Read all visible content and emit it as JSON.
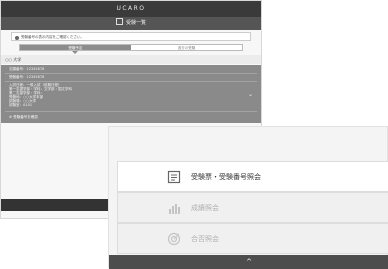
{
  "app": {
    "brand": "UCARO"
  },
  "header": {
    "title": "受験一覧"
  },
  "notice": {
    "text": "受験番号の表示内容をご確認ください。"
  },
  "tabs": [
    {
      "label": "受験予定",
      "active": true
    },
    {
      "label": "過去の受験",
      "active": false
    }
  ],
  "section": {
    "title": "○○ 大学"
  },
  "panel": {
    "rows": [
      "志願番号：12345678",
      "受験番号：12345678",
      "入試日程：一般入試（前期日程）",
      "第一志望学部・学科：文学部・国文学科",
      "第二志望学部・学科：",
      "受験地：○○大学本部",
      "試験場：○○大学",
      "試験室：A101"
    ],
    "footer": "受験番号を確認"
  },
  "menu": {
    "items": [
      {
        "label": "受験票・受験番号照会",
        "icon": "document-list-icon",
        "enabled": true
      },
      {
        "label": "成績照会",
        "icon": "bar-chart-icon",
        "enabled": false
      },
      {
        "label": "合否照会",
        "icon": "target-icon",
        "enabled": false
      }
    ]
  },
  "bottom": {
    "chevron": "^"
  },
  "colors": {
    "dark_bar": "#3a3a3a",
    "panel": "#8a8a8a",
    "bottom_bar": "#4d4d4d"
  }
}
